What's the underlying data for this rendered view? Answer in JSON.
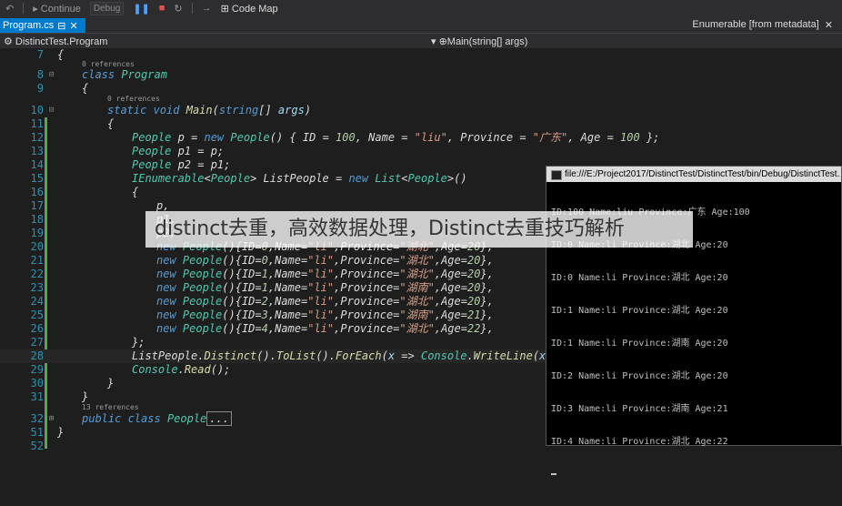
{
  "toolbar": {
    "continue_label": "Continue",
    "config_value": "Debug",
    "codemap_label": "Code Map"
  },
  "tabs": {
    "active": "Program.cs",
    "metadata": "Enumerable [from metadata]"
  },
  "navbar": {
    "type": "DistinctTest.Program",
    "member": "Main(string[] args)"
  },
  "code": {
    "lines": [
      {
        "n": "7"
      },
      {
        "n": "8"
      },
      {
        "n": "9"
      },
      {
        "n": "10"
      },
      {
        "n": "11"
      },
      {
        "n": "12"
      },
      {
        "n": "13"
      },
      {
        "n": "14"
      },
      {
        "n": "15"
      },
      {
        "n": "16"
      },
      {
        "n": "17"
      },
      {
        "n": "18"
      },
      {
        "n": "19"
      },
      {
        "n": "20"
      },
      {
        "n": "21"
      },
      {
        "n": "22"
      },
      {
        "n": "23"
      },
      {
        "n": "24"
      },
      {
        "n": "25"
      },
      {
        "n": "26"
      },
      {
        "n": "27"
      },
      {
        "n": "28"
      },
      {
        "n": "29"
      },
      {
        "n": "30"
      },
      {
        "n": "31"
      },
      {
        "n": "32"
      },
      {
        "n": "51"
      },
      {
        "n": "52"
      }
    ],
    "refs_0": "0 references",
    "refs_13": "13 references"
  },
  "console": {
    "title": "file:///E:/Project2017/DistinctTest/DistinctTest/bin/Debug/DistinctTest.",
    "output": [
      "ID:100 Name:liu Province:广东 Age:100",
      "ID:0 Name:li Province:湖北 Age:20",
      "ID:0 Name:li Province:湖北 Age:20",
      "ID:1 Name:li Province:湖北 Age:20",
      "ID:1 Name:li Province:湖南 Age:20",
      "ID:2 Name:li Province:湖北 Age:20",
      "ID:3 Name:li Province:湖南 Age:21",
      "ID:4 Name:li Province:湖北 Age:22"
    ]
  },
  "watermark": "distinct去重，高效数据处理，Distinct去重技巧解析"
}
